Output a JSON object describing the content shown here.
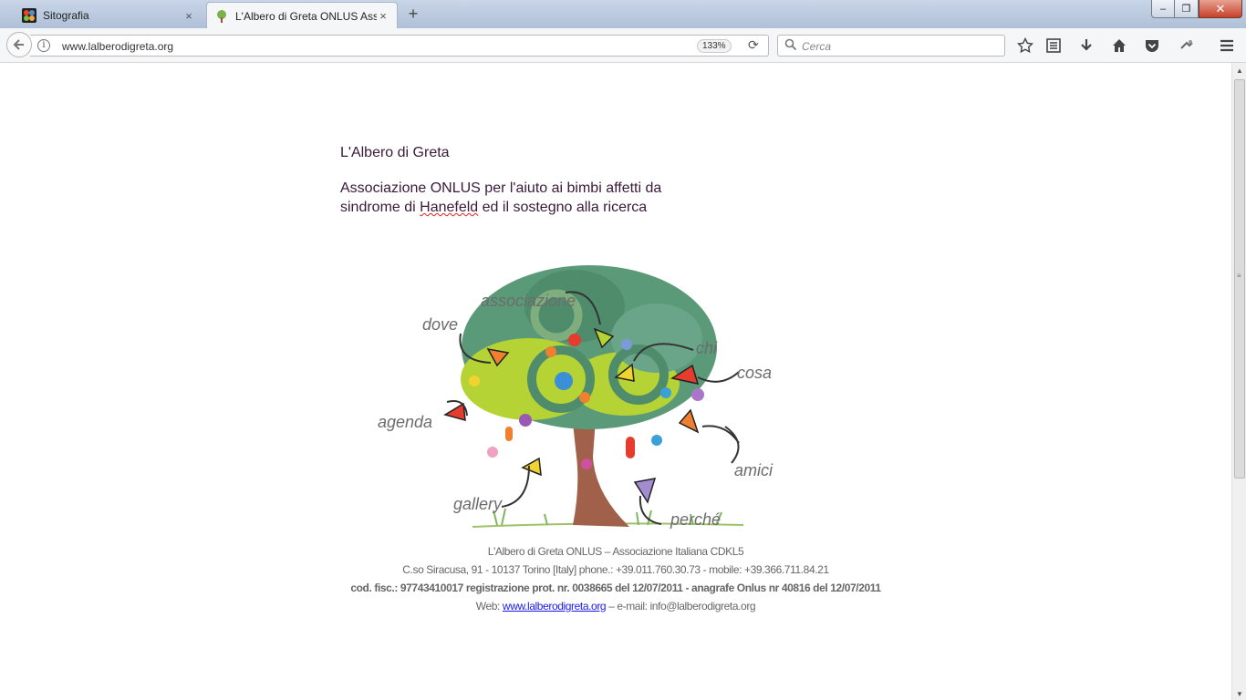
{
  "tabs": [
    {
      "title": "Sitografia",
      "close": "×"
    },
    {
      "title": "L'Albero di Greta ONLUS Associazione",
      "close": "×"
    }
  ],
  "new_tab": "+",
  "window_controls": {
    "minimize": "–",
    "maximize": "❐",
    "close": "✕"
  },
  "navbar": {
    "url": "www.lalberodigreta.org",
    "zoom": "133%",
    "search_placeholder": "Cerca"
  },
  "page": {
    "title": "L'Albero di Greta",
    "desc_line1": "Associazione ONLUS per l'aiuto ai bimbi affetti da",
    "desc_line2_before": "sindrome di ",
    "desc_line2_word": "Hanefeld",
    "desc_line2_after": " ed il sostegno alla ricerca",
    "tree_labels": {
      "associazione": "associazione",
      "dove": "dove",
      "chi": "chi",
      "cosa": "cosa",
      "agenda": "agenda",
      "amici": "amici",
      "gallery": "gallery",
      "perche": "perché"
    },
    "footer": {
      "line1": "L'Albero di Greta ONLUS – Associazione Italiana CDKL5",
      "line2": "C.so Siracusa, 91 -  10137 Torino [Italy]  phone.: +39.011.760.30.73  - mobile: +39.366.711.84.21",
      "line3": "cod. fisc.: 97743410017  registrazione prot. nr. 0038665 del 12/07/2011  - anagrafe Onlus nr 40816 del 12/07/2011",
      "web_label": "Web: ",
      "web_link": "www.lalberodigreta.org",
      "email": " – e-mail: info@lalberodigreta.org"
    }
  },
  "colors": {
    "link": "#1a1aee",
    "text": "#3a1a3a",
    "trunk": "#a0604a",
    "leaf_green": "#5a9a78",
    "lime": "#b5d334"
  }
}
